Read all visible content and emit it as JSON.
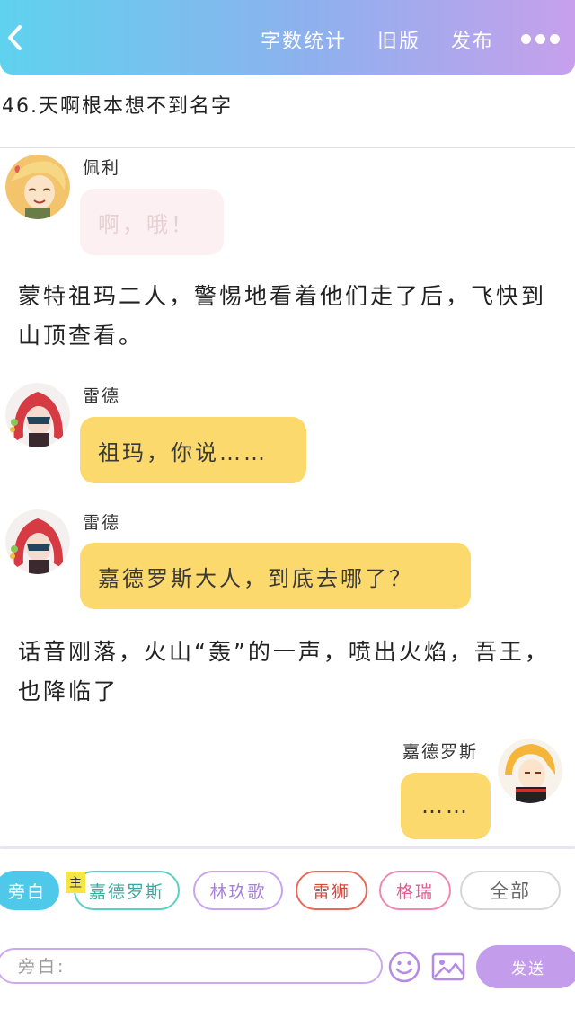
{
  "header": {
    "back_icon": "chevron-left-icon",
    "word_count_label": "字数统计",
    "old_version_label": "旧版",
    "publish_label": "发布",
    "more_icon": "ellipsis-icon"
  },
  "chapter": {
    "title": "46.天啊根本想不到名字"
  },
  "messages": [
    {
      "type": "dialogue",
      "speaker": "佩利",
      "text": "啊，哦！",
      "side": "left",
      "style": "pink"
    },
    {
      "type": "narration",
      "text": "蒙特祖玛二人，警惕地看着他们走了后，飞快到山顶查看。"
    },
    {
      "type": "dialogue",
      "speaker": "雷德",
      "text": "祖玛，你说……",
      "side": "left",
      "style": "yellow"
    },
    {
      "type": "dialogue",
      "speaker": "雷德",
      "text": "嘉德罗斯大人，到底去哪了？",
      "side": "left",
      "style": "yellow"
    },
    {
      "type": "narration",
      "text": "话音刚落，火山“轰”的一声，喷出火焰，吾王，也降临了"
    },
    {
      "type": "dialogue",
      "speaker": "嘉德罗斯",
      "text": "……",
      "side": "right",
      "style": "yellow"
    }
  ],
  "role_tags": {
    "narrator": "旁白",
    "main_badge": "主",
    "roles": [
      "嘉德罗斯",
      "林玖歌",
      "雷狮",
      "格瑞"
    ],
    "all_label": "全部"
  },
  "composer": {
    "placeholder": "旁白:",
    "emoji_icon": "smiley-icon",
    "image_icon": "image-icon",
    "send_label": "发送"
  },
  "colors": {
    "header_gradient": [
      "#5fd2ee",
      "#c7a0ec"
    ],
    "bubble_yellow": "#fcd96c",
    "bubble_pink": "#fdf0f2",
    "narrator_tag": "#4ec9ea",
    "send_button": "#c39ceb"
  }
}
